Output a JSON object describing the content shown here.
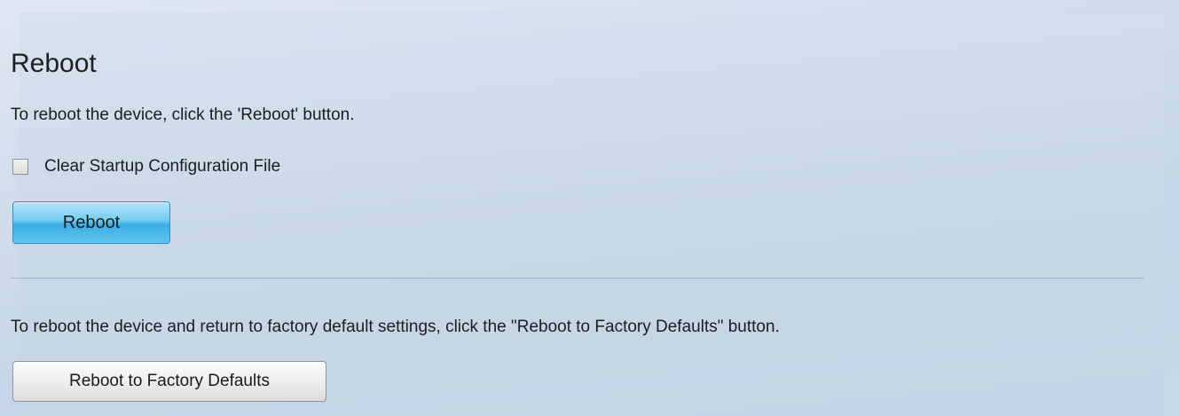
{
  "page": {
    "title": "Reboot"
  },
  "reboot_section": {
    "instruction": "To reboot the device, click the 'Reboot' button.",
    "checkbox": {
      "label": "Clear Startup Configuration File",
      "checked": false
    },
    "reboot_button_label": "Reboot"
  },
  "factory_section": {
    "instruction": "To reboot the device and return to factory default settings, click the \"Reboot to Factory Defaults\" button.",
    "factory_button_label": "Reboot to Factory Defaults"
  },
  "colors": {
    "primary_button": "#5fc3ee",
    "background": "#c9d8e8"
  }
}
